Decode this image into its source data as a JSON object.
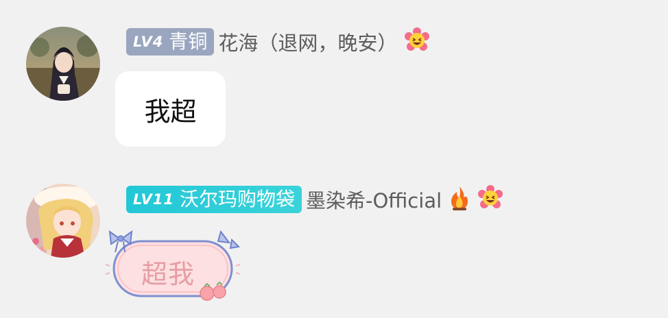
{
  "messages": [
    {
      "level": "LV4",
      "rank": "青铜",
      "nickname": "花海（退网，晚安）",
      "text": "我超",
      "emoji": "flower-grin-icon"
    },
    {
      "level": "LV11",
      "rank": "沃尔玛购物袋",
      "nickname": "墨染希-Official",
      "text": "超我",
      "emoji": "flower-grin-icon",
      "fire": "fire-icon"
    }
  ],
  "colors": {
    "background": "#f1f1f1",
    "badge_lv4": "#9aa6bf",
    "badge_lv11": "#2ccbd8",
    "nickname": "#5c5c5c",
    "decorated_text": "#e59ea4"
  }
}
